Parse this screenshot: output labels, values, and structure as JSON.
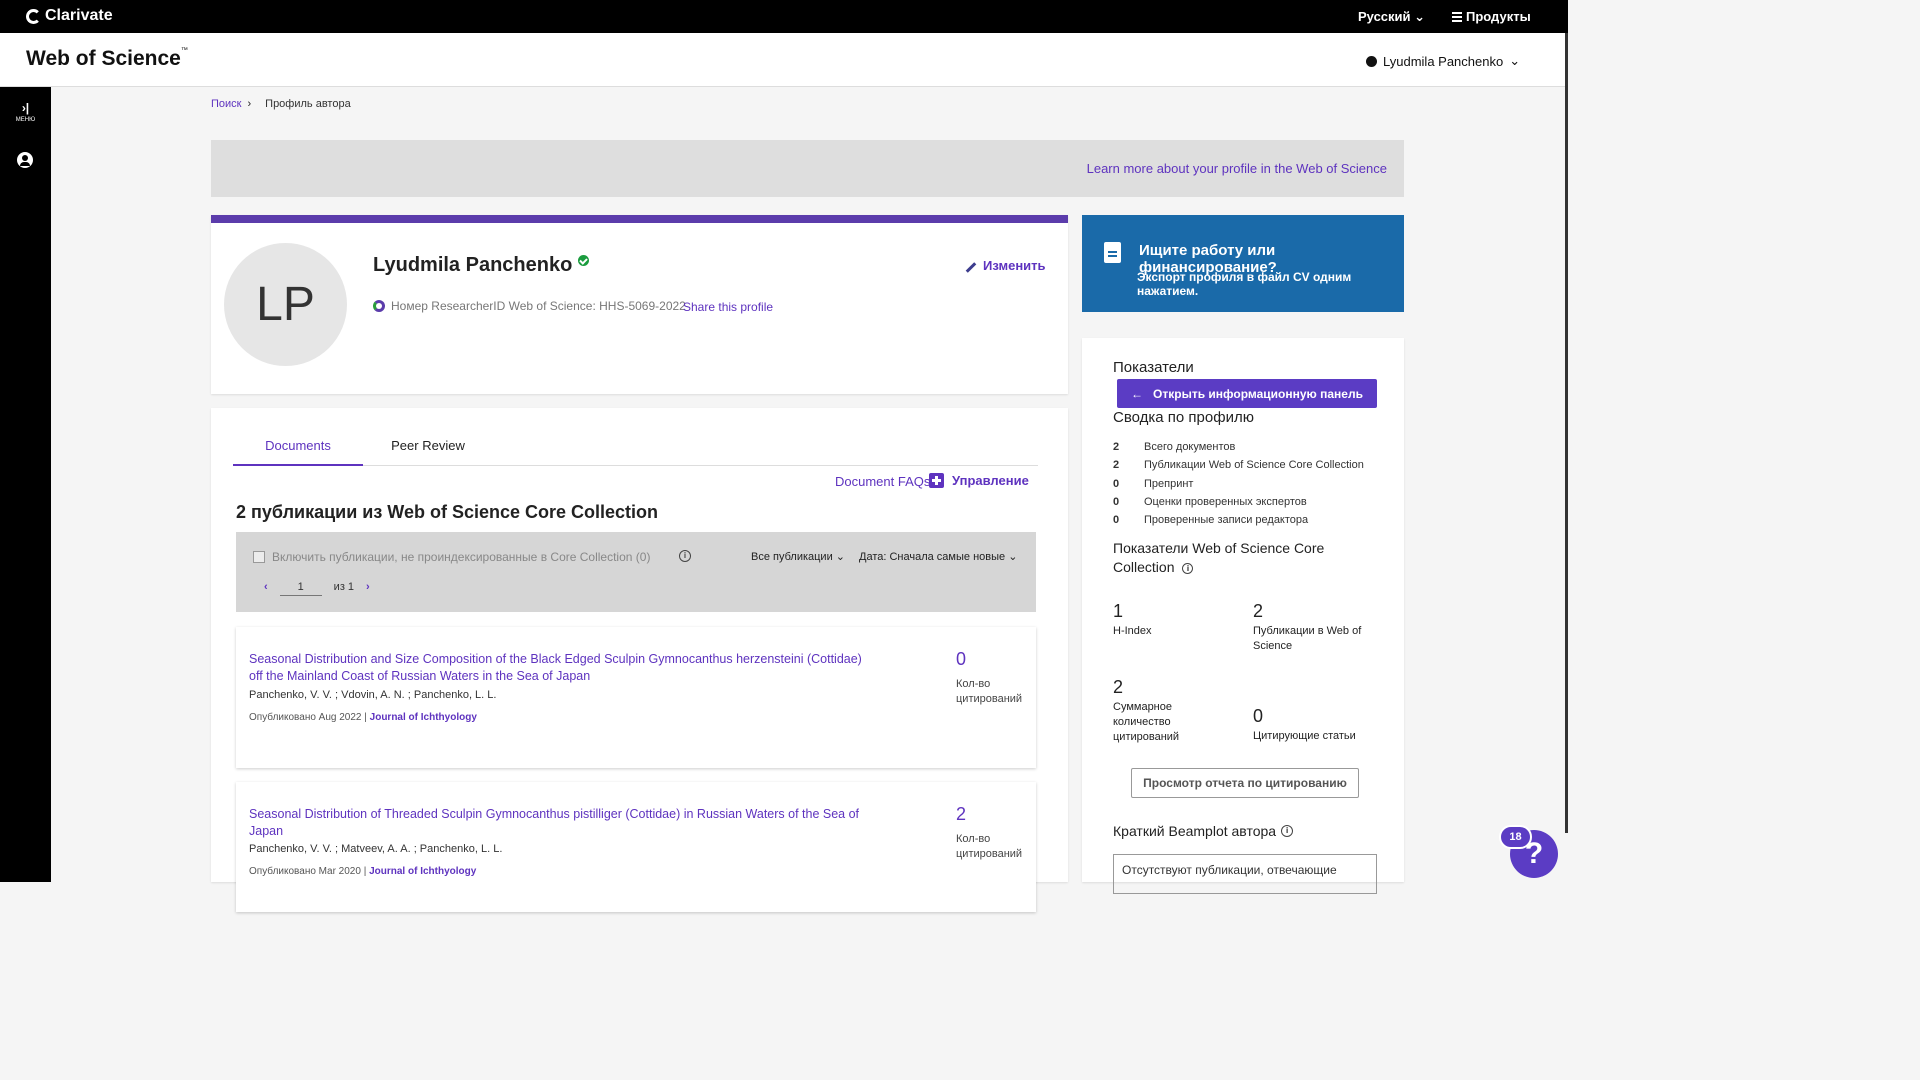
{
  "topbar": {
    "brand": "Clarivate",
    "language": "Русский",
    "products": "Продукты"
  },
  "header": {
    "logo": "Web of Science",
    "logo_tm": "™",
    "user_name": "Lyudmila Panchenko"
  },
  "rail": {
    "menu_label": "МЕНЮ"
  },
  "breadcrumb": {
    "search": "Поиск",
    "current": "Профиль автора"
  },
  "banner": {
    "link": "Learn more about your profile in the Web of Science"
  },
  "profile": {
    "initials": "LP",
    "name": "Lyudmila Panchenko",
    "researcher_id": "Номер ResearcherID Web of Science: HHS-5069-2022",
    "share": "Share this profile",
    "edit": "Изменить",
    "accent_color": "#5b3cab"
  },
  "cv_card": {
    "title": "Ищите работу или финансирование?",
    "subtitle": "Экспорт профиля в файл CV одним нажатием.",
    "color": "#1a6aa9"
  },
  "documents": {
    "tabs": [
      {
        "label": "Documents"
      },
      {
        "label": "Peer Review"
      }
    ],
    "faq": "Document FAQs",
    "manage": "Управление",
    "heading": "2 публикации из Web of Science Core Collection",
    "filter": {
      "include_label": "Включить публикации, не проиндексированные в Core Collection (0)",
      "all_pubs": "Все публикации",
      "sort": "Дата: Сначала самые новые",
      "page": "1",
      "of_label": "из 1"
    },
    "items": [
      {
        "title": "Seasonal Distribution and Size Composition of the Black Edged Sculpin Gymnocanthus herzensteini (Cottidae) off the Mainland Coast of Russian Waters in the Sea of Japan",
        "authors": "Panchenko, V. V. ; Vdovin, A. N. ; Panchenko, L. L.",
        "published": "Опубликовано Aug 2022 | ",
        "journal": "Journal of Ichthyology",
        "citations": "0",
        "citations_label": "Кол-во цитирований"
      },
      {
        "title": "Seasonal Distribution of Threaded Sculpin Gymnocanthus pistilliger (Cottidae) in Russian Waters of the Sea of Japan",
        "authors": "Panchenko, V. V. ; Matveev, A. A. ; Panchenko, L. L.",
        "published": "Опубликовано Mar 2020 | ",
        "journal": "Journal of Ichthyology",
        "citations": "2",
        "citations_label": "Кол-во цитирований"
      }
    ]
  },
  "metrics": {
    "title": "Показатели",
    "dashboard_button": "Открыть информационную панель",
    "summary_title": "Сводка по профилю",
    "summary": [
      {
        "n": "2",
        "label": "Всего документов"
      },
      {
        "n": "2",
        "label": "Публикации Web of Science Core Collection"
      },
      {
        "n": "0",
        "label": "Препринт"
      },
      {
        "n": "0",
        "label": "Оценки проверенных экспертов"
      },
      {
        "n": "0",
        "label": "Проверенные записи редактора"
      }
    ],
    "wos_title": "Показатели Web of Science Core Collection",
    "stats": [
      {
        "value": "1",
        "label": "H-Index"
      },
      {
        "value": "2",
        "label": "Публикации в Web of Science"
      },
      {
        "value": "2",
        "label": "Суммарное количество цитирований"
      },
      {
        "value": "0",
        "label": "Цитирующие статьи"
      }
    ],
    "report_button": "Просмотр отчета по цитированию",
    "beamplot_title": "Краткий Beamplot автора",
    "beamplot_text": "Отсутствуют публикации, отвечающие"
  },
  "help": {
    "badge": "18",
    "glyph": "?"
  }
}
